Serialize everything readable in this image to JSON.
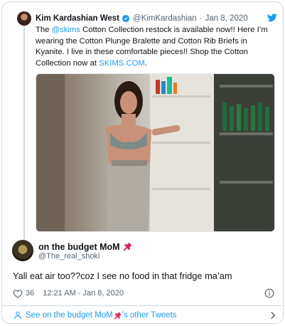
{
  "parent_tweet": {
    "author_name": "Kim Kardashian West",
    "author_handle": "@KimKardashian",
    "separator": "·",
    "date": "Jan 8, 2020",
    "text_pre": "The ",
    "mention": "@skims",
    "text_mid": " Cotton Collection restock is available now!! Here I’m wearing the Cotton Plunge Bralette and Cotton Rib Briefs in Kyanite. I live in these comfortable pieces!! Shop the Cotton Collection now at ",
    "url_text": "SKIMS.COM",
    "text_post": "."
  },
  "reply_tweet": {
    "author_name": "on the budget MoM",
    "author_handle": "@The_real_shoki",
    "text": "Yall eat air too??coz I see no food in that fridge ma’am",
    "like_count": "36",
    "timestamp": "12:21 AM - Jan 8, 2020"
  },
  "footer": {
    "link_prefix": "See on the budget MoM",
    "link_suffix": "'s other Tweets"
  },
  "colors": {
    "accent": "#1d9bf0",
    "border": "#cfd9de",
    "secondary_text": "#536471",
    "pin_red": "#e0245e"
  }
}
